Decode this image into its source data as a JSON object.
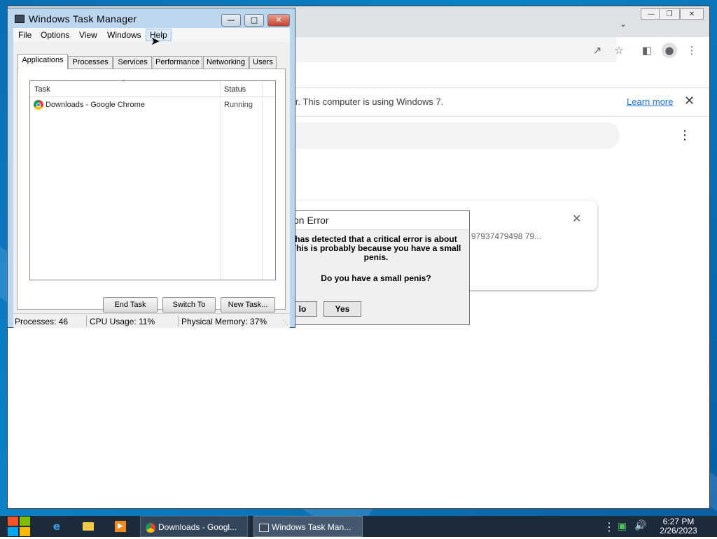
{
  "chrome": {
    "infobar_text": "ter. This computer is using Windows 7.",
    "learn_more": "Learn more",
    "download_text": "97937479498 79..."
  },
  "error_dialog": {
    "title": "on Error",
    "line1": "has detected that a critical error is about",
    "line2": "This is probably because you have a small",
    "line3": "penis.",
    "question": "Do you have a small penis?",
    "no_label": "lo",
    "yes_label": "Yes"
  },
  "task_manager": {
    "title": "Windows Task Manager",
    "menu": [
      "File",
      "Options",
      "View",
      "Windows",
      "Help"
    ],
    "tabs": [
      "Applications",
      "Processes",
      "Services",
      "Performance",
      "Networking",
      "Users"
    ],
    "columns": {
      "task": "Task",
      "status": "Status"
    },
    "rows": [
      {
        "task": "Downloads - Google Chrome",
        "status": "Running"
      }
    ],
    "buttons": {
      "end_task": "End Task",
      "switch_to": "Switch To",
      "new_task": "New Task..."
    },
    "status_bar": {
      "processes": "Processes: 46",
      "cpu": "CPU Usage: 11%",
      "memory": "Physical Memory: 37%"
    }
  },
  "taskbar": {
    "tasks": [
      "Downloads - Googl...",
      "Windows Task Man..."
    ],
    "time": "6:27 PM",
    "date": "2/26/2023"
  },
  "colors": {
    "desktop": "#0b82c8",
    "taskbar": "#1c2a3a",
    "link": "#1a73e8",
    "tm_frame": "#bcd6ee"
  }
}
